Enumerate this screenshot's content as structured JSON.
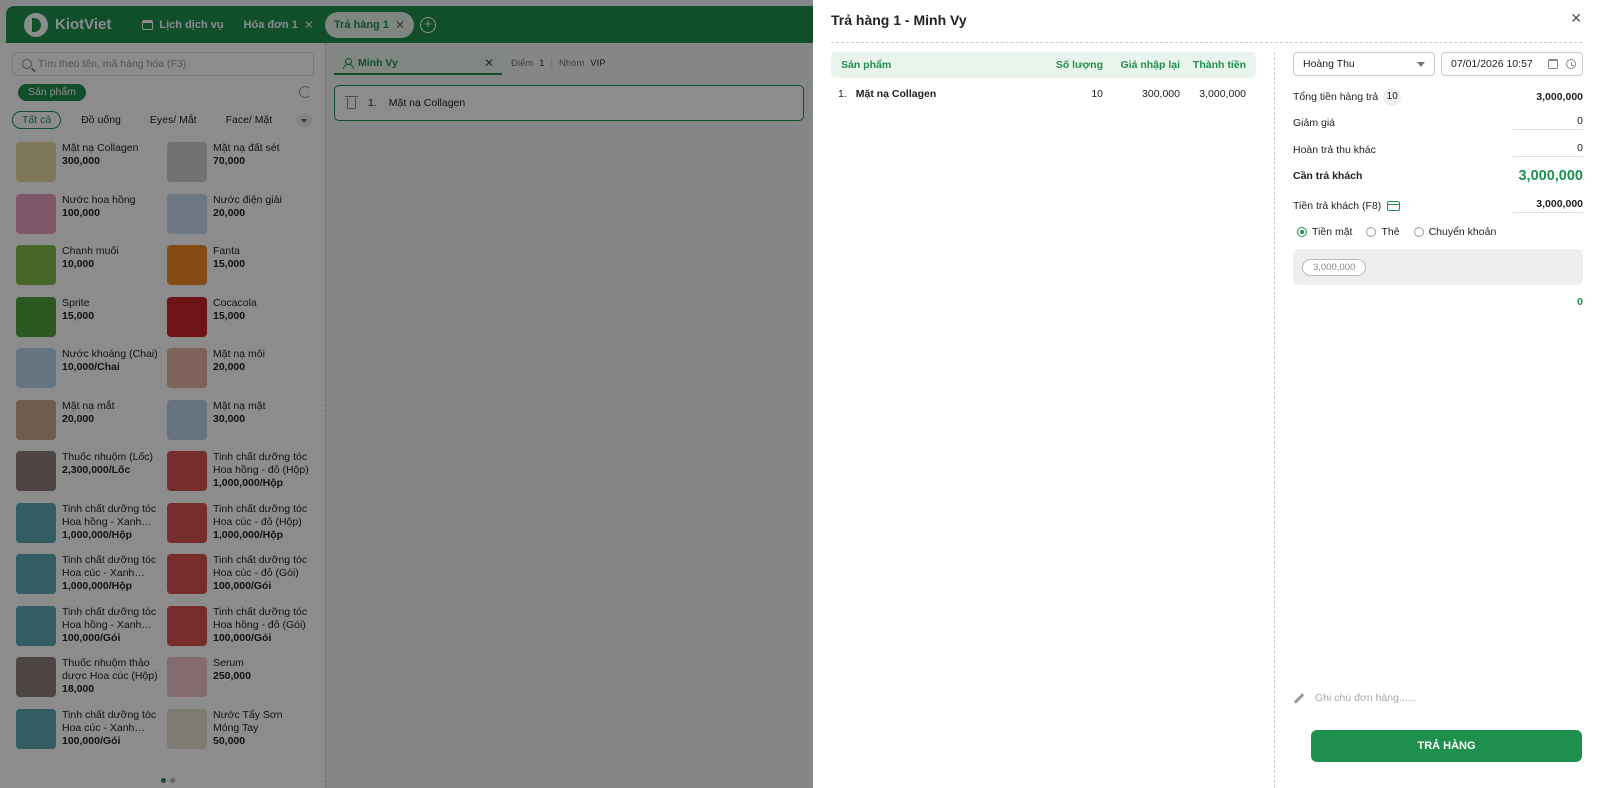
{
  "app": {
    "brand": "KiotViet",
    "tabs": [
      {
        "label": "Lịch dịch vụ"
      },
      {
        "label": "Hóa đơn 1"
      },
      {
        "label": "Trả hàng 1"
      }
    ],
    "close_glyph": "✕",
    "add_glyph": "+"
  },
  "left": {
    "search_placeholder": "Tìm theo tên, mã hàng hóa (F3)",
    "filter_chip": "Sản phẩm",
    "categories": [
      "Tất cả",
      "Đồ uống",
      "Eyes/ Mắt",
      "Face/ Mặt"
    ],
    "products": [
      {
        "name": "Mặt nạ Collagen",
        "price": "300,000",
        "thumb": "#e8dca3"
      },
      {
        "name": "Mặt nạ đất sét",
        "price": "70,000",
        "thumb": "#cfcfcf"
      },
      {
        "name": "Nước hoa hồng",
        "price": "100,000",
        "thumb": "#e79fbf"
      },
      {
        "name": "Nước điện giải",
        "price": "20,000",
        "thumb": "#c9d9f0"
      },
      {
        "name": "Chanh muối",
        "price": "10,000",
        "thumb": "#7fba4a"
      },
      {
        "name": "Fanta",
        "price": "15,000",
        "thumb": "#f08a24"
      },
      {
        "name": "Sprite",
        "price": "15,000",
        "thumb": "#4f9e3c"
      },
      {
        "name": "Cocacola",
        "price": "15,000",
        "thumb": "#c9252a"
      },
      {
        "name": "Nước khoáng (Chai)",
        "price": "10,000/Chai",
        "thumb": "#bcd6ee"
      },
      {
        "name": "Mặt nạ môi",
        "price": "20,000",
        "thumb": "#e6b3a3"
      },
      {
        "name": "Mặt nạ mắt",
        "price": "20,000",
        "thumb": "#c8a98b"
      },
      {
        "name": "Mặt nạ mặt",
        "price": "30,000",
        "thumb": "#b7d2e8"
      },
      {
        "name": "Thuốc nhuộm (Lốc)",
        "price": "2,300,000/Lốc",
        "thumb": "#8c7f77"
      },
      {
        "name": "Tinh chất dưỡng tóc Hoa hồng - đỏ (Hộp)",
        "price": "1,000,000/Hộp",
        "thumb": "#d9534f"
      },
      {
        "name": "Tinh chất dưỡng tóc Hoa hồng - Xanh (Hộp)",
        "price": "1,000,000/Hộp",
        "thumb": "#5aa9b5"
      },
      {
        "name": "Tinh chất dưỡng tóc Hoa cúc - đỏ (Hộp)",
        "price": "1,000,000/Hộp",
        "thumb": "#d9534f"
      },
      {
        "name": "Tinh chất dưỡng tóc Hoa cúc - Xanh (Hộp)",
        "price": "1,000,000/Hộp",
        "thumb": "#5aa9b5"
      },
      {
        "name": "Tinh chất dưỡng tóc Hoa cúc - đỏ (Gói)",
        "price": "100,000/Gói",
        "thumb": "#d9534f"
      },
      {
        "name": "Tinh chất dưỡng tóc Hoa hồng - Xanh (Gói)",
        "price": "100,000/Gói",
        "thumb": "#5aa9b5"
      },
      {
        "name": "Tinh chất dưỡng tóc Hoa hồng - đỏ (Gói)",
        "price": "100,000/Gói",
        "thumb": "#d9534f"
      },
      {
        "name": "Thuốc nhuộm thảo dược Hoa cúc (Hộp)",
        "price": "18,000",
        "thumb": "#8c7f77"
      },
      {
        "name": "Serum",
        "price": "250,000",
        "thumb": "#f1c4cc"
      },
      {
        "name": "Tinh chất dưỡng tóc Hoa cúc - Xanh (Gói)",
        "price": "100,000/Gói",
        "thumb": "#5aa9b5"
      },
      {
        "name": "Nước Tẩy Sơn Móng Tay",
        "price": "50,000",
        "thumb": "#eadfd6"
      }
    ]
  },
  "mid": {
    "customer": "Minh Vy",
    "points_label": "Điểm",
    "points_value": "1",
    "group_label": "Nhóm",
    "group_value": "VIP",
    "cart_item": {
      "index": "1.",
      "name": "Mặt nạ Collagen"
    }
  },
  "modal": {
    "title": "Trả hàng 1 - Minh Vy",
    "close_glyph": "✕",
    "table": {
      "headers": {
        "product": "Sản phẩm",
        "qty": "Số lượng",
        "price": "Giá nhập lại",
        "total": "Thành tiền"
      },
      "rows": [
        {
          "index": "1.",
          "name": "Mặt nạ Collagen",
          "qty": "10",
          "price": "300,000",
          "total": "3,000,000"
        }
      ]
    },
    "staff": "Hoàng Thu",
    "datetime": "07/01/2026 10:57",
    "summary": {
      "total_label": "Tổng tiền hàng trả",
      "total_count": "10",
      "total_value": "3,000,000",
      "discount_label": "Giảm giá",
      "discount_value": "0",
      "refund_other_label": "Hoàn trả thu khác",
      "refund_other_value": "0",
      "need_pay_label": "Cần trả khách",
      "need_pay_value": "3,000,000",
      "paid_label": "Tiền trả khách (F8)",
      "paid_value": "3,000,000",
      "methods": [
        "Tiền mặt",
        "Thẻ",
        "Chuyển khoản"
      ],
      "suggestion": "3,000,000",
      "change_value": "0"
    },
    "note_placeholder": "Ghi chú đơn hàng......",
    "submit_label": "TRẢ HÀNG"
  }
}
